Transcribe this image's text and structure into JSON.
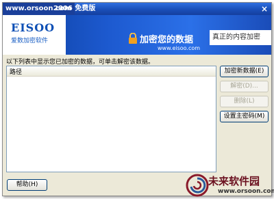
{
  "titlebar": {
    "watermark": "www.orsoon.com",
    "title": "2006 免费版",
    "close_glyph": "×"
  },
  "banner": {
    "logo": "EISOO",
    "logo_sub": "爱数加密软件",
    "slogan": "加密您的数据",
    "site": "www.eisoo.com",
    "tagline": "真正的内容加密"
  },
  "main": {
    "hint": "以下列表中显示您已加密的数据，可单击解密该数据。",
    "list_header": "路径"
  },
  "buttons": {
    "encrypt_new": "加密新数据(E)",
    "decrypt": "解密(D)...",
    "delete": "删除(L)",
    "set_master_password": "设置主密码(M)",
    "help": "帮助(H)"
  },
  "brand_watermark": {
    "name": "未来软件园",
    "url": "www.orsoon.com"
  },
  "colors": {
    "titlebar": "#1a4fb9",
    "banner": "#1d5ad0",
    "accent_lock": "#f0a020"
  }
}
